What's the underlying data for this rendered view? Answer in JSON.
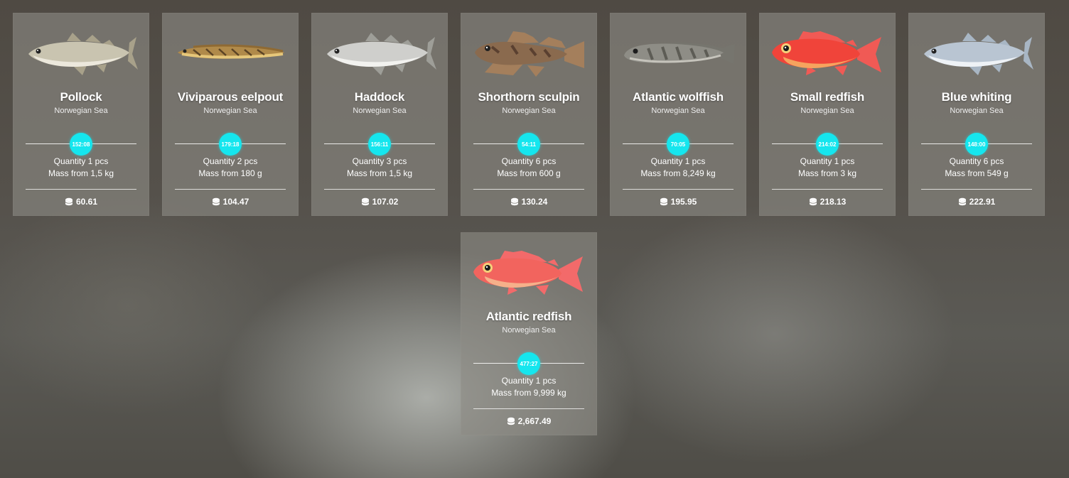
{
  "fish": [
    {
      "name": "Pollock",
      "region": "Norwegian Sea",
      "timer": "152:08",
      "quantity": "Quantity 1 pcs",
      "mass": "Mass from 1,5 kg",
      "price": "60.61",
      "icon": "pollock-fish",
      "colors": {
        "body": "#c9c4b0",
        "belly": "#ece8dc",
        "fin": "#a8a18a"
      }
    },
    {
      "name": "Viviparous eelpout",
      "region": "Norwegian Sea",
      "timer": "179:18",
      "quantity": "Quantity 2 pcs",
      "mass": "Mass from 180 g",
      "price": "104.47",
      "icon": "eelpout-fish",
      "colors": {
        "body": "#b08a4a",
        "belly": "#e6c77a",
        "fin": "#8f6a33"
      }
    },
    {
      "name": "Haddock",
      "region": "Norwegian Sea",
      "timer": "156:11",
      "quantity": "Quantity 3 pcs",
      "mass": "Mass from 1,5 kg",
      "price": "107.02",
      "icon": "haddock-fish",
      "colors": {
        "body": "#cfcfcc",
        "belly": "#f2f2ef",
        "fin": "#9e9e98"
      }
    },
    {
      "name": "Shorthorn sculpin",
      "region": "Norwegian Sea",
      "timer": "54:11",
      "quantity": "Quantity 6 pcs",
      "mass": "Mass from 600 g",
      "price": "130.24",
      "icon": "sculpin-fish",
      "colors": {
        "body": "#8a6a4e",
        "belly": "#c7a98a",
        "fin": "#a47f5c"
      }
    },
    {
      "name": "Atlantic wolffish",
      "region": "Norwegian Sea",
      "timer": "70:05",
      "quantity": "Quantity 1 pcs",
      "mass": "Mass from 8,249 kg",
      "price": "195.95",
      "icon": "wolffish-fish",
      "colors": {
        "body": "#8e8d86",
        "belly": "#c6c4bc",
        "fin": "#76756e"
      }
    },
    {
      "name": "Small redfish",
      "region": "Norwegian Sea",
      "timer": "214:02",
      "quantity": "Quantity 1 pcs",
      "mass": "Mass from 3 kg",
      "price": "218.13",
      "icon": "redfish-fish",
      "colors": {
        "body": "#f0443a",
        "belly": "#f6a35e",
        "fin": "#f05a55"
      }
    },
    {
      "name": "Blue whiting",
      "region": "Norwegian Sea",
      "timer": "148:00",
      "quantity": "Quantity 6 pcs",
      "mass": "Mass from 549 g",
      "price": "222.91",
      "icon": "whiting-fish",
      "colors": {
        "body": "#b9c5d2",
        "belly": "#eef2f6",
        "fin": "#a8b6c4"
      }
    },
    {
      "name": "Atlantic redfish",
      "region": "Norwegian Sea",
      "timer": "477:27",
      "quantity": "Quantity 1 pcs",
      "mass": "Mass from 9,999 kg",
      "price": "2,667.49",
      "icon": "atlantic-redfish-fish",
      "colors": {
        "body": "#f2645e",
        "belly": "#f6b08a",
        "fin": "#f36a6a"
      }
    }
  ],
  "accent": "#15e6ee"
}
